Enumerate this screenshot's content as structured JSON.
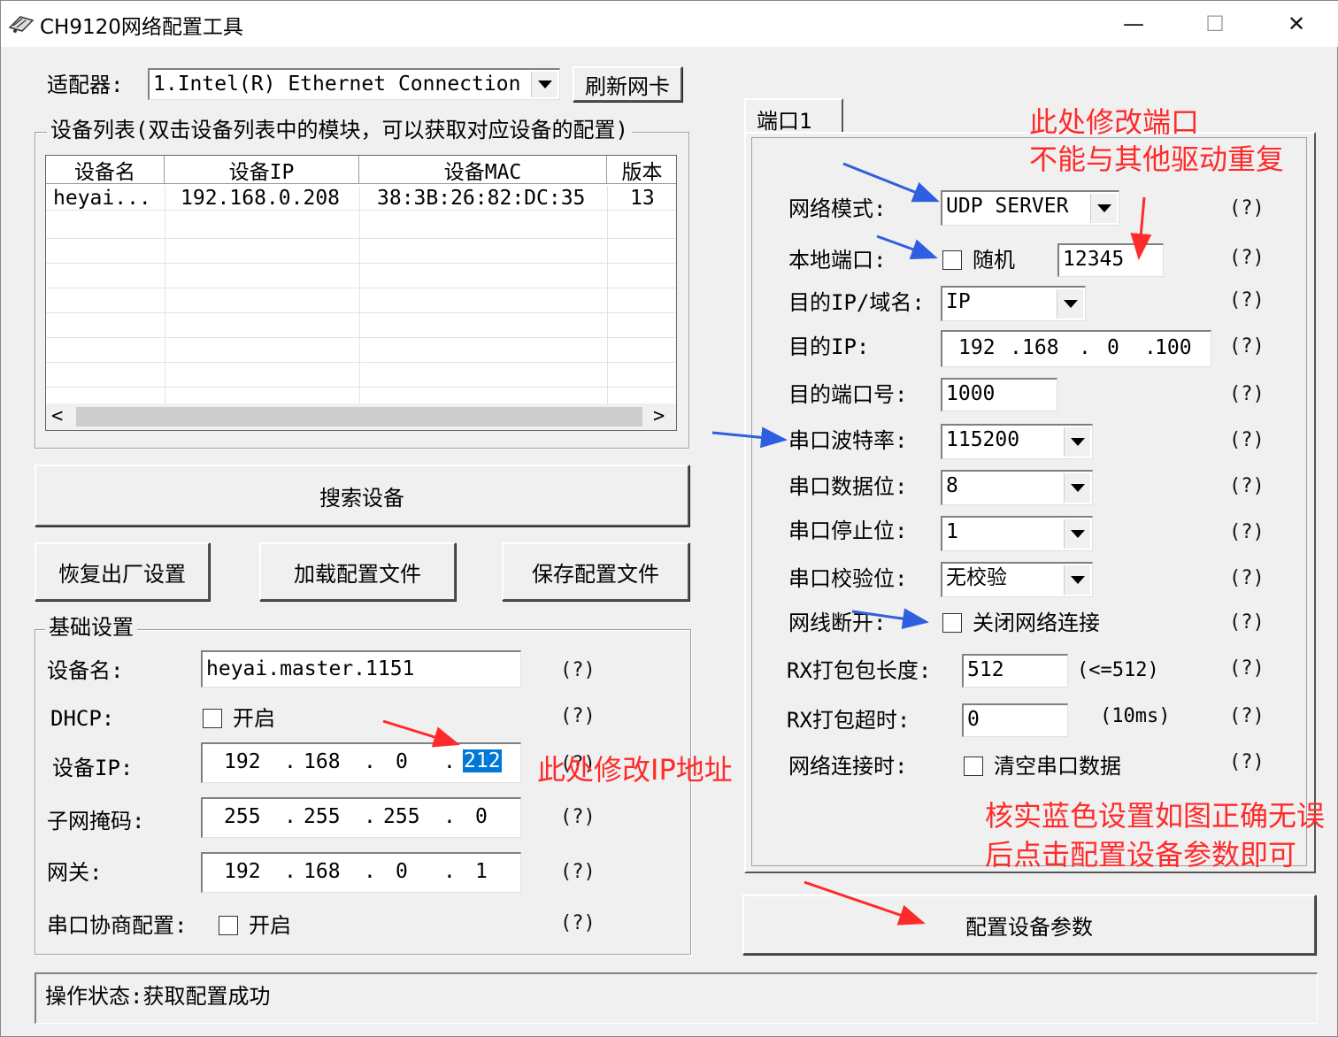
{
  "window": {
    "title": "CH9120网络配置工具",
    "minimize": "—",
    "maximize": "☐",
    "close": "✕"
  },
  "adapter": {
    "label": "适配器:",
    "value": "1.Intel(R) Ethernet Connection",
    "refresh_label": "刷新网卡"
  },
  "device_list": {
    "title": "设备列表(双击设备列表中的模块，可以获取对应设备的配置)",
    "columns": [
      "设备名",
      "设备IP",
      "设备MAC",
      "版本"
    ],
    "rows": [
      {
        "name": "heyai...",
        "ip": "192.168.0.208",
        "mac": "38:3B:26:82:DC:35",
        "version": "13"
      }
    ],
    "scroll_left": "<",
    "scroll_right": ">"
  },
  "buttons": {
    "search": "搜索设备",
    "restore": "恢复出厂设置",
    "load": "加载配置文件",
    "save": "保存配置文件",
    "configure": "配置设备参数"
  },
  "basic": {
    "title": "基础设置",
    "device_name_label": "设备名:",
    "device_name": "heyai.master.1151",
    "dhcp_label": "DHCP:",
    "dhcp_option": "开启",
    "ip_label": "设备IP:",
    "ip": [
      "192",
      "168",
      "0",
      "212"
    ],
    "mask_label": "子网掩码:",
    "mask": [
      "255",
      "255",
      "255",
      "0"
    ],
    "gateway_label": "网关:",
    "gateway": [
      "192",
      "168",
      "0",
      "1"
    ],
    "serial_neg_label": "串口协商配置:",
    "serial_neg_option": "开启",
    "help": "(?)"
  },
  "port": {
    "tab": "端口1",
    "mode_label": "网络模式:",
    "mode": "UDP SERVER",
    "local_port_label": "本地端口:",
    "random_label": "随机",
    "local_port": "12345",
    "dest_type_label": "目的IP/域名:",
    "dest_type": "IP",
    "dest_ip_label": "目的IP:",
    "dest_ip": [
      "192",
      "168",
      "0",
      "100"
    ],
    "dest_port_label": "目的端口号:",
    "dest_port": "1000",
    "baud_label": "串口波特率:",
    "baud": "115200",
    "databits_label": "串口数据位:",
    "databits": "8",
    "stopbits_label": "串口停止位:",
    "stopbits": "1",
    "parity_label": "串口校验位:",
    "parity": "无校验",
    "netdisc_label": "网线断开:",
    "netdisc_option": "关闭网络连接",
    "rx_len_label": "RX打包包长度:",
    "rx_len": "512",
    "rx_len_hint": "(<=512)",
    "rx_timeout_label": "RX打包超时:",
    "rx_timeout": "0",
    "rx_timeout_hint": "(10ms)",
    "onconnect_label": "网络连接时:",
    "onconnect_option": "清空串口数据",
    "help": "(?)"
  },
  "status": {
    "text": "操作状态:获取配置成功"
  },
  "annotations": {
    "port_note_line1": "此处修改端口",
    "port_note_line2": "不能与其他驱动重复",
    "ip_note": "此处修改IP地址",
    "verify_line1": "核实蓝色设置如图正确无误",
    "verify_line2": "后点击配置设备参数即可"
  },
  "colors": {
    "annotation_red": "#ff2a2a",
    "arrow_blue": "#2f5fe0",
    "selection": "#0078d7"
  }
}
